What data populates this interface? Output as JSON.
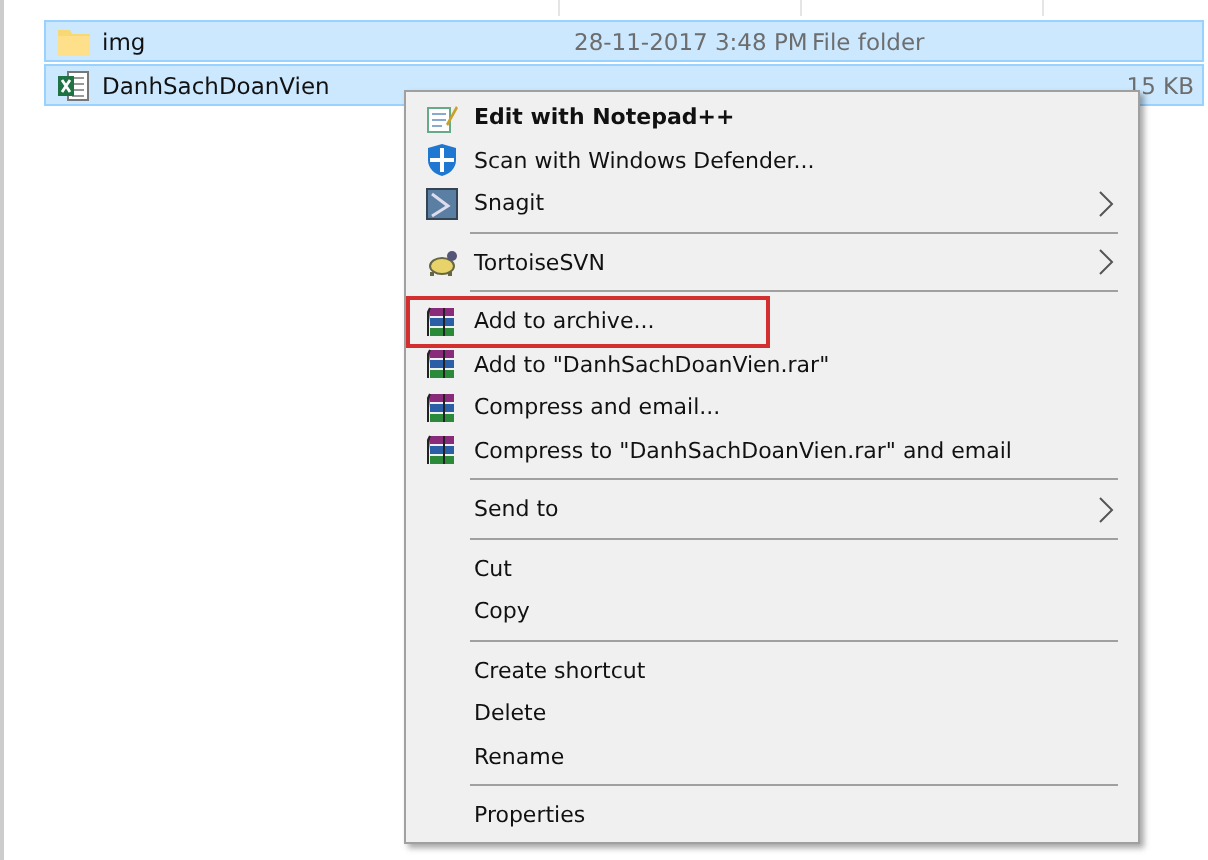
{
  "files": [
    {
      "name": "img",
      "date": "28-11-2017 3:48 PM",
      "type": "File folder",
      "selected": true
    },
    {
      "name": "DanhSachDoanVien",
      "size": "15 KB",
      "selected": true
    }
  ],
  "context_menu": {
    "items": [
      {
        "kind": "item",
        "label": "Edit with Notepad++",
        "bold": true,
        "submenu": false,
        "highlighted": false
      },
      {
        "kind": "item",
        "label": "Scan with Windows Defender...",
        "bold": false,
        "submenu": false,
        "highlighted": false
      },
      {
        "kind": "item",
        "label": "Snagit",
        "bold": false,
        "submenu": true,
        "highlighted": false
      },
      {
        "kind": "separator"
      },
      {
        "kind": "item",
        "label": "TortoiseSVN",
        "bold": false,
        "submenu": true,
        "highlighted": false
      },
      {
        "kind": "separator"
      },
      {
        "kind": "item",
        "label": "Add to archive...",
        "bold": false,
        "submenu": false,
        "highlighted": true
      },
      {
        "kind": "item",
        "label": "Add to \"DanhSachDoanVien.rar\"",
        "bold": false,
        "submenu": false,
        "highlighted": false
      },
      {
        "kind": "item",
        "label": "Compress and email...",
        "bold": false,
        "submenu": false,
        "highlighted": false
      },
      {
        "kind": "item",
        "label": "Compress to \"DanhSachDoanVien.rar\" and email",
        "bold": false,
        "submenu": false,
        "highlighted": false
      },
      {
        "kind": "separator"
      },
      {
        "kind": "item",
        "label": "Send to",
        "bold": false,
        "submenu": true,
        "highlighted": false
      },
      {
        "kind": "separator"
      },
      {
        "kind": "item",
        "label": "Cut",
        "bold": false,
        "submenu": false,
        "highlighted": false
      },
      {
        "kind": "item",
        "label": "Copy",
        "bold": false,
        "submenu": false,
        "highlighted": false
      },
      {
        "kind": "separator"
      },
      {
        "kind": "item",
        "label": "Create shortcut",
        "bold": false,
        "submenu": false,
        "highlighted": false
      },
      {
        "kind": "item",
        "label": "Delete",
        "bold": false,
        "submenu": false,
        "highlighted": false
      },
      {
        "kind": "item",
        "label": "Rename",
        "bold": false,
        "submenu": false,
        "highlighted": false
      },
      {
        "kind": "separator"
      },
      {
        "kind": "item",
        "label": "Properties",
        "bold": false,
        "submenu": false,
        "highlighted": false
      }
    ]
  }
}
